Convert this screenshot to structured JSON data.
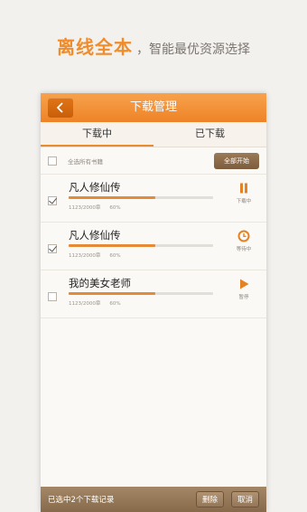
{
  "promo": {
    "headline": "离线全本",
    "subline": "，智能最优资源选择"
  },
  "app": {
    "title": "下载管理",
    "tabs": [
      {
        "label": "下载中",
        "active": true
      },
      {
        "label": "已下载",
        "active": false
      }
    ],
    "select_all_label": "全选所有书籍",
    "start_all_label": "全部开始",
    "items": [
      {
        "name": "凡人修仙传",
        "chapters": "1123/2000章",
        "percent": "60%",
        "progress": 0.6,
        "checked": true,
        "action_icon": "pause-icon",
        "action_label": "下载中"
      },
      {
        "name": "凡人修仙传",
        "chapters": "1123/2000章",
        "percent": "60%",
        "progress": 0.6,
        "checked": true,
        "action_icon": "clock-icon",
        "action_label": "等待中"
      },
      {
        "name": "我的美女老师",
        "chapters": "1123/2000章",
        "percent": "60%",
        "progress": 0.6,
        "checked": false,
        "action_icon": "play-icon",
        "action_label": "暂停"
      }
    ],
    "footer": {
      "status": "已选中2个下载记录",
      "delete_label": "删除",
      "cancel_label": "取消"
    }
  },
  "colors": {
    "accent": "#ee8327",
    "progress": "#e58b37",
    "footer": "#876a4b"
  }
}
